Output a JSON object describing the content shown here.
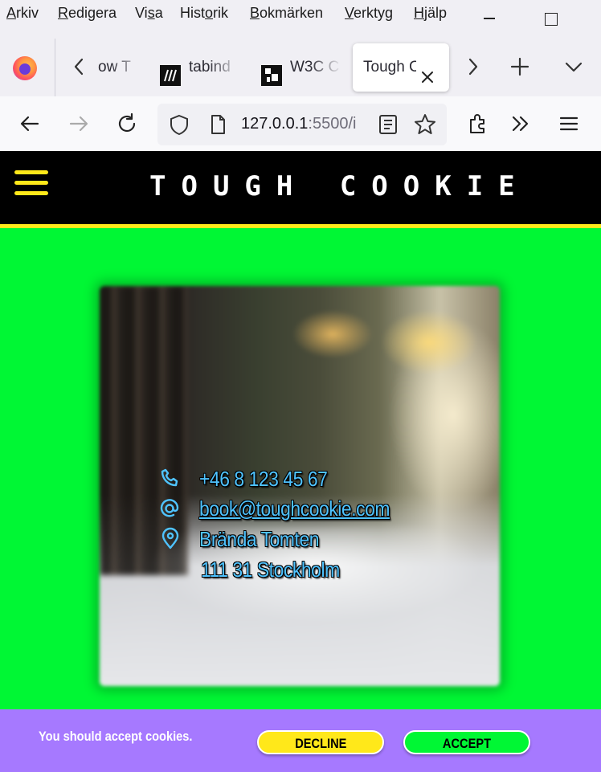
{
  "menubar": {
    "items": [
      {
        "u": "A",
        "rest": "rkiv"
      },
      {
        "u": "R",
        "rest": "edigera"
      },
      {
        "pre": "Vi",
        "u": "s",
        "rest": "a"
      },
      {
        "pre": "Hist",
        "u": "o",
        "rest": "rik"
      },
      {
        "u": "B",
        "rest": "okmärken"
      },
      {
        "u": "V",
        "rest": "erktyg"
      },
      {
        "u": "H",
        "rest": "jälp"
      }
    ]
  },
  "tabs": [
    {
      "title": "ow T"
    },
    {
      "title": "tabind"
    },
    {
      "title": "W3C C"
    },
    {
      "title": "Tough C",
      "active": true
    }
  ],
  "url": {
    "main": "127.0.0.1",
    "dim": ":5500/i"
  },
  "site": {
    "title": "TOUGH COOKIE",
    "phone": "+46 8 123 45 67",
    "email": "book@toughcookie.com",
    "address_line1": "Brända Tomten",
    "address_line2": "111 31 Stockholm"
  },
  "cookie": {
    "message": "You should accept cookies.",
    "decline_label": "DECLINE",
    "accept_label": "ACCEPT"
  },
  "colors": {
    "page_bg": "#00f734",
    "header_bg": "#000000",
    "accent_yellow": "#ffe81a",
    "cookie_bg": "#a679ff",
    "contact_text": "#4fc3ff"
  }
}
